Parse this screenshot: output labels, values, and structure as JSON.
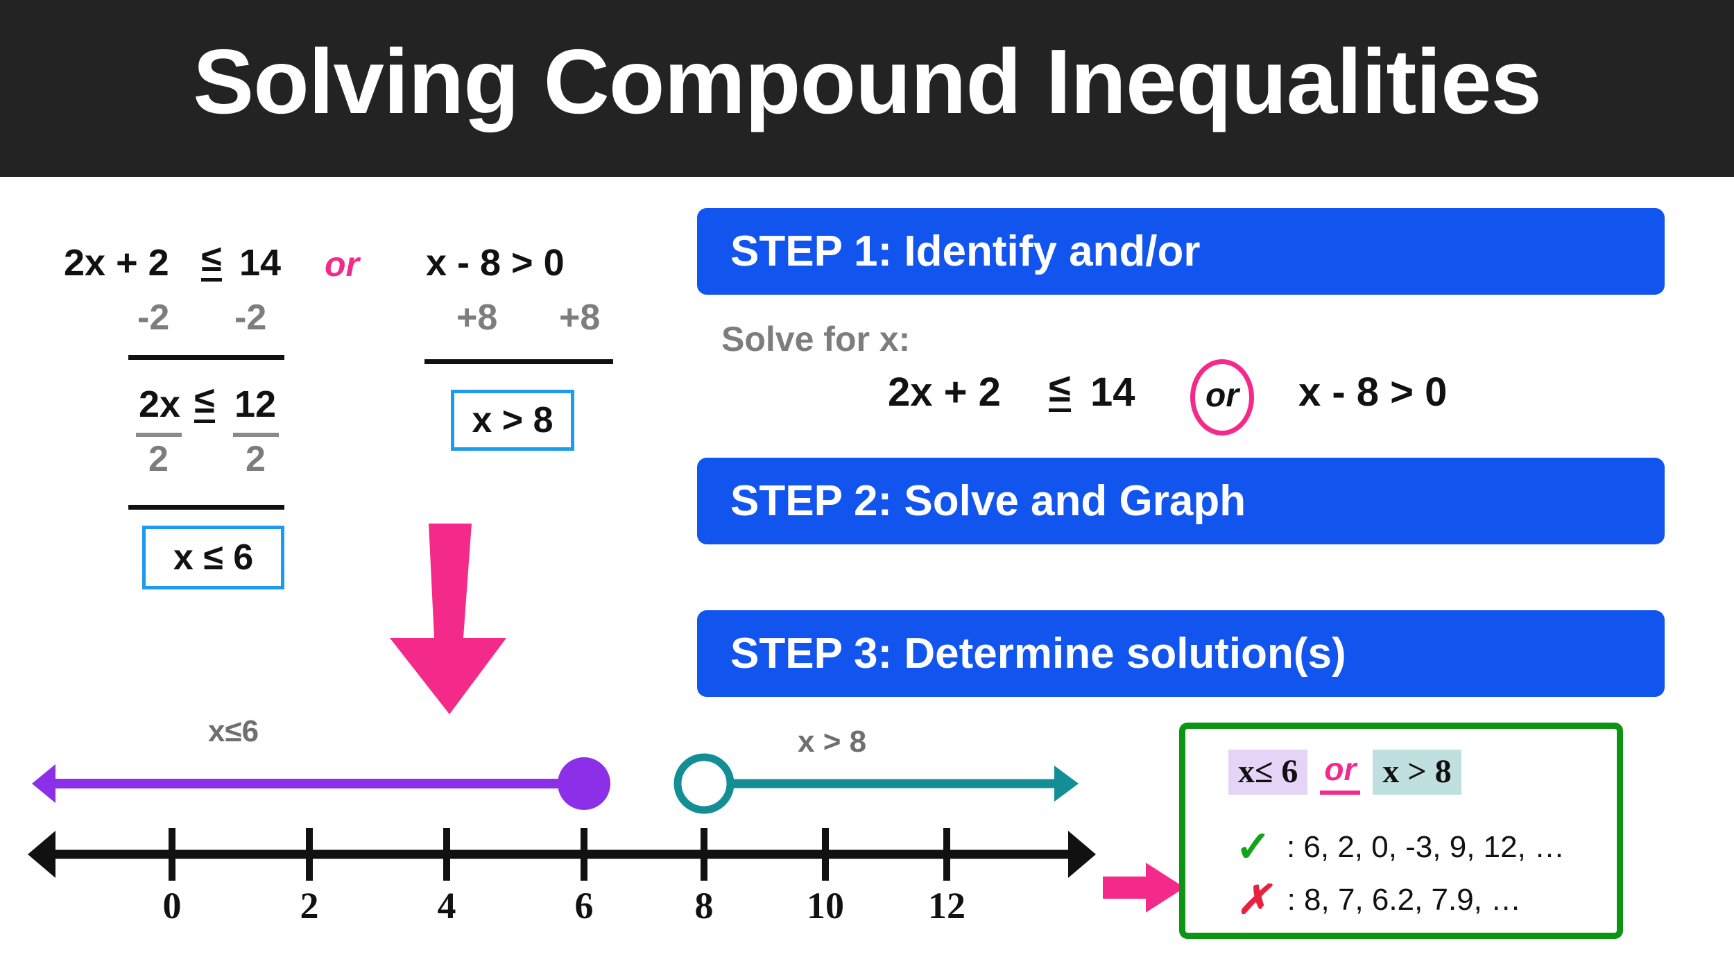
{
  "header": {
    "title": "Solving Compound Inequalities"
  },
  "work": {
    "left": {
      "line1": "2x + 2",
      "line1_rel": "≤",
      "line1_rhs": "14",
      "op_left": "-2",
      "op_right": "-2",
      "line2_lhs": "2x",
      "line2_rel": "≤",
      "line2_rhs": "12",
      "div_left": "2",
      "div_right": "2",
      "answer": "x ≤ 6"
    },
    "connector": "or",
    "right": {
      "line1": "x - 8 > 0",
      "op_left": "+8",
      "op_right": "+8",
      "answer": "x > 8"
    }
  },
  "steps": [
    {
      "label": "STEP 1: Identify and/or"
    },
    {
      "label": "STEP 2: Solve and Graph"
    },
    {
      "label": "STEP 3: Determine solution(s)"
    }
  ],
  "solve": {
    "label": "Solve for x:",
    "left_expr": "2x + 2",
    "rel": "≤",
    "left_rhs": "14",
    "circled_or": "or",
    "right_expr": "x - 8 > 0"
  },
  "numberline": {
    "left_label": "x≤6",
    "right_label": "x > 8",
    "tick_values": [
      "0",
      "2",
      "4",
      "6",
      "8",
      "10",
      "12"
    ],
    "closed_point": "6",
    "open_point": "8"
  },
  "solution_box": {
    "left_chip": "x≤ 6",
    "connector": "or",
    "right_chip": "x > 8",
    "check_mark": "✓",
    "check_values": ": 6, 2, 0, -3, 9, 12, …",
    "cross_mark": "✗",
    "cross_values": ": 8, 7, 6.2, 7.9, …"
  },
  "chart_data": {
    "type": "line",
    "title": "Solving Compound Inequalities",
    "xlabel": "",
    "ylabel": "",
    "xlim": [
      -1.2,
      13.5
    ],
    "grid": false,
    "legend": "none",
    "categories": [
      "0",
      "2",
      "4",
      "6",
      "8",
      "10",
      "12"
    ],
    "x": [
      0,
      2,
      4,
      6,
      8,
      10,
      12
    ],
    "series": [
      {
        "name": "x ≤ 6",
        "type": "ray",
        "endpoint": 6,
        "endpoint_style": "closed",
        "direction": "left",
        "color": "#8b2fe8",
        "label": "x≤6"
      },
      {
        "name": "x > 8",
        "type": "ray",
        "endpoint": 8,
        "endpoint_style": "open",
        "direction": "right",
        "color": "#148e96",
        "label": "x > 8"
      }
    ],
    "annotations": [
      "2x + 2 ≤ 14 or x - 8 > 0",
      "x ≤ 6",
      "x > 8",
      "Solutions: 6, 2, 0, -3, 9, 12, …",
      "Non-solutions: 8, 7, 6.2, 7.9, …"
    ]
  },
  "colors": {
    "header_bg": "#232323",
    "step_blue": "#1155ee",
    "pink": "#f42a8a",
    "purple_ray": "#8b2fe8",
    "teal_ray": "#148e96",
    "green_border": "#0c9412",
    "box_blue": "#1c9cee",
    "gray_text": "#7d7d7d",
    "lavender_hl": "#e5d4f5",
    "teal_hl": "#bfe0de"
  }
}
